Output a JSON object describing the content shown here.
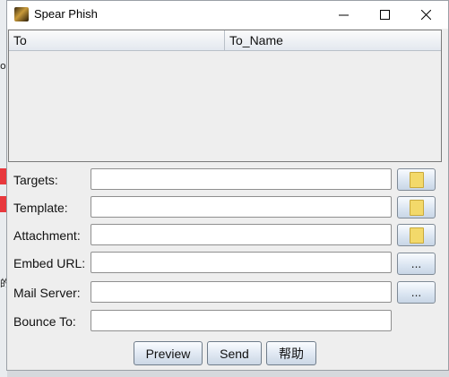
{
  "background": {
    "fragments": [
      "ot",
      "的"
    ]
  },
  "window": {
    "title": "Spear Phish",
    "controls": [
      "minimize",
      "maximize",
      "close"
    ]
  },
  "table": {
    "columns": [
      "To",
      "To_Name"
    ],
    "rows": []
  },
  "form": {
    "targets_label": "Targets:",
    "targets_value": "",
    "template_label": "Template:",
    "template_value": "",
    "attachment_label": "Attachment:",
    "attachment_value": "",
    "embed_url_label": "Embed URL:",
    "embed_url_value": "",
    "mail_server_label": "Mail Server:",
    "mail_server_value": "",
    "bounce_to_label": "Bounce To:",
    "bounce_to_value": "",
    "browse_ellipsis": "..."
  },
  "buttons": {
    "preview": "Preview",
    "send": "Send",
    "help": "帮助"
  },
  "colors": {
    "window_bg": "#eeeeee",
    "titlebar_bg": "#ffffff",
    "accent_red": "#e8383d"
  }
}
